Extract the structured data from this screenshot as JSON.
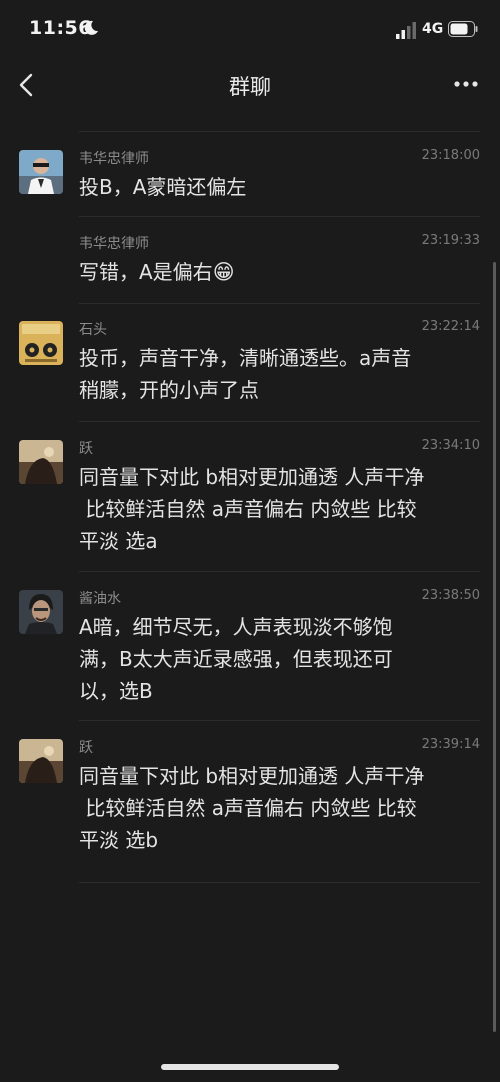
{
  "status_bar": {
    "time": "11:56",
    "network": "4G"
  },
  "nav": {
    "title": "群聊"
  },
  "messages": [
    {
      "sender": "韦华忠律师",
      "time": "23:18:00",
      "text": "投B，A蒙暗还偏左",
      "avatar": "lawyer-avatar"
    },
    {
      "sender": "韦华忠律师",
      "time": "23:19:33",
      "text": "写错，A是偏右",
      "emoji": "😁"
    },
    {
      "sender": "石头",
      "time": "23:22:14",
      "text": "投币，声音干净，清晰通透些。a声音\n稍朦，开的小声了点",
      "avatar": "album-avatar"
    },
    {
      "sender": "跃",
      "time": "23:34:10",
      "text": "同音量下对此 b相对更加通透 人声干净\n 比较鲜活自然 a声音偏右 内敛些 比较\n平淡 选a",
      "avatar": "photo-avatar"
    },
    {
      "sender": "酱油水",
      "time": "23:38:50",
      "text": "A暗，细节尽无，人声表现淡不够饱\n满，B太大声近录感强，但表现还可\n以，选B",
      "avatar": "portrait-avatar"
    },
    {
      "sender": "跃",
      "time": "23:39:14",
      "text": "同音量下对此 b相对更加通透 人声干净\n 比较鲜活自然 a声音偏右 内敛些 比较\n平淡 选b",
      "avatar": "photo-avatar"
    }
  ]
}
